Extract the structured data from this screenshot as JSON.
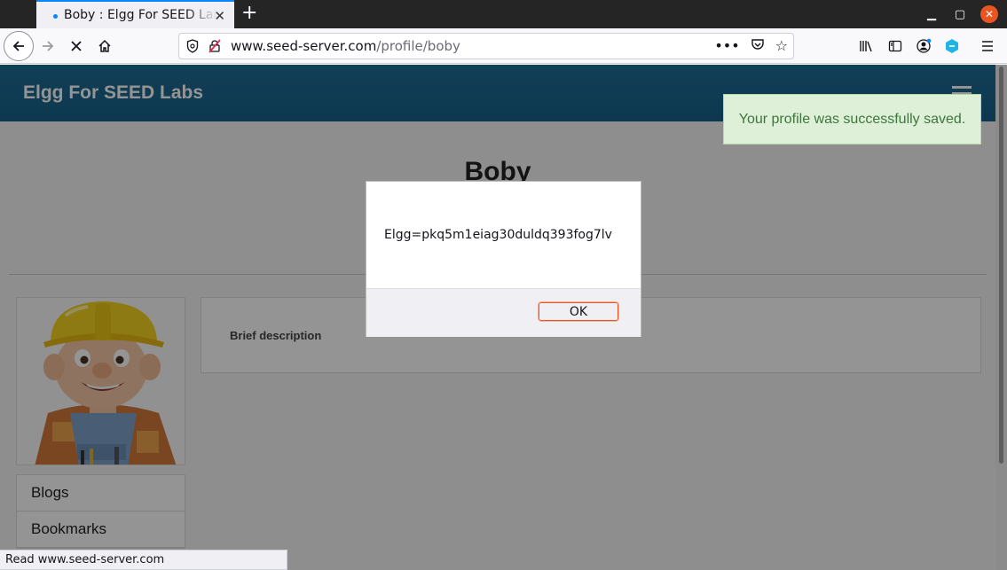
{
  "browser": {
    "tab_title": "Boby : Elgg For SEED Labs",
    "url_host": "www.seed-server.com",
    "url_path": "/profile/boby",
    "status_text": "Read www.seed-server.com"
  },
  "site": {
    "brand": "Elgg For SEED Labs"
  },
  "profile": {
    "name": "Boby",
    "brief_description_label": "Brief description",
    "menu": [
      "Blogs",
      "Bookmarks"
    ]
  },
  "flash": {
    "message": "Your profile was successfully saved."
  },
  "alert": {
    "message": "Elgg=pkq5m1eiag30duldq393fog7lv",
    "ok_label": "OK"
  },
  "colors": {
    "header": "#1c6b93",
    "flash_bg": "#dff0d8",
    "flash_text": "#3c763d",
    "accent": "#e95420"
  }
}
